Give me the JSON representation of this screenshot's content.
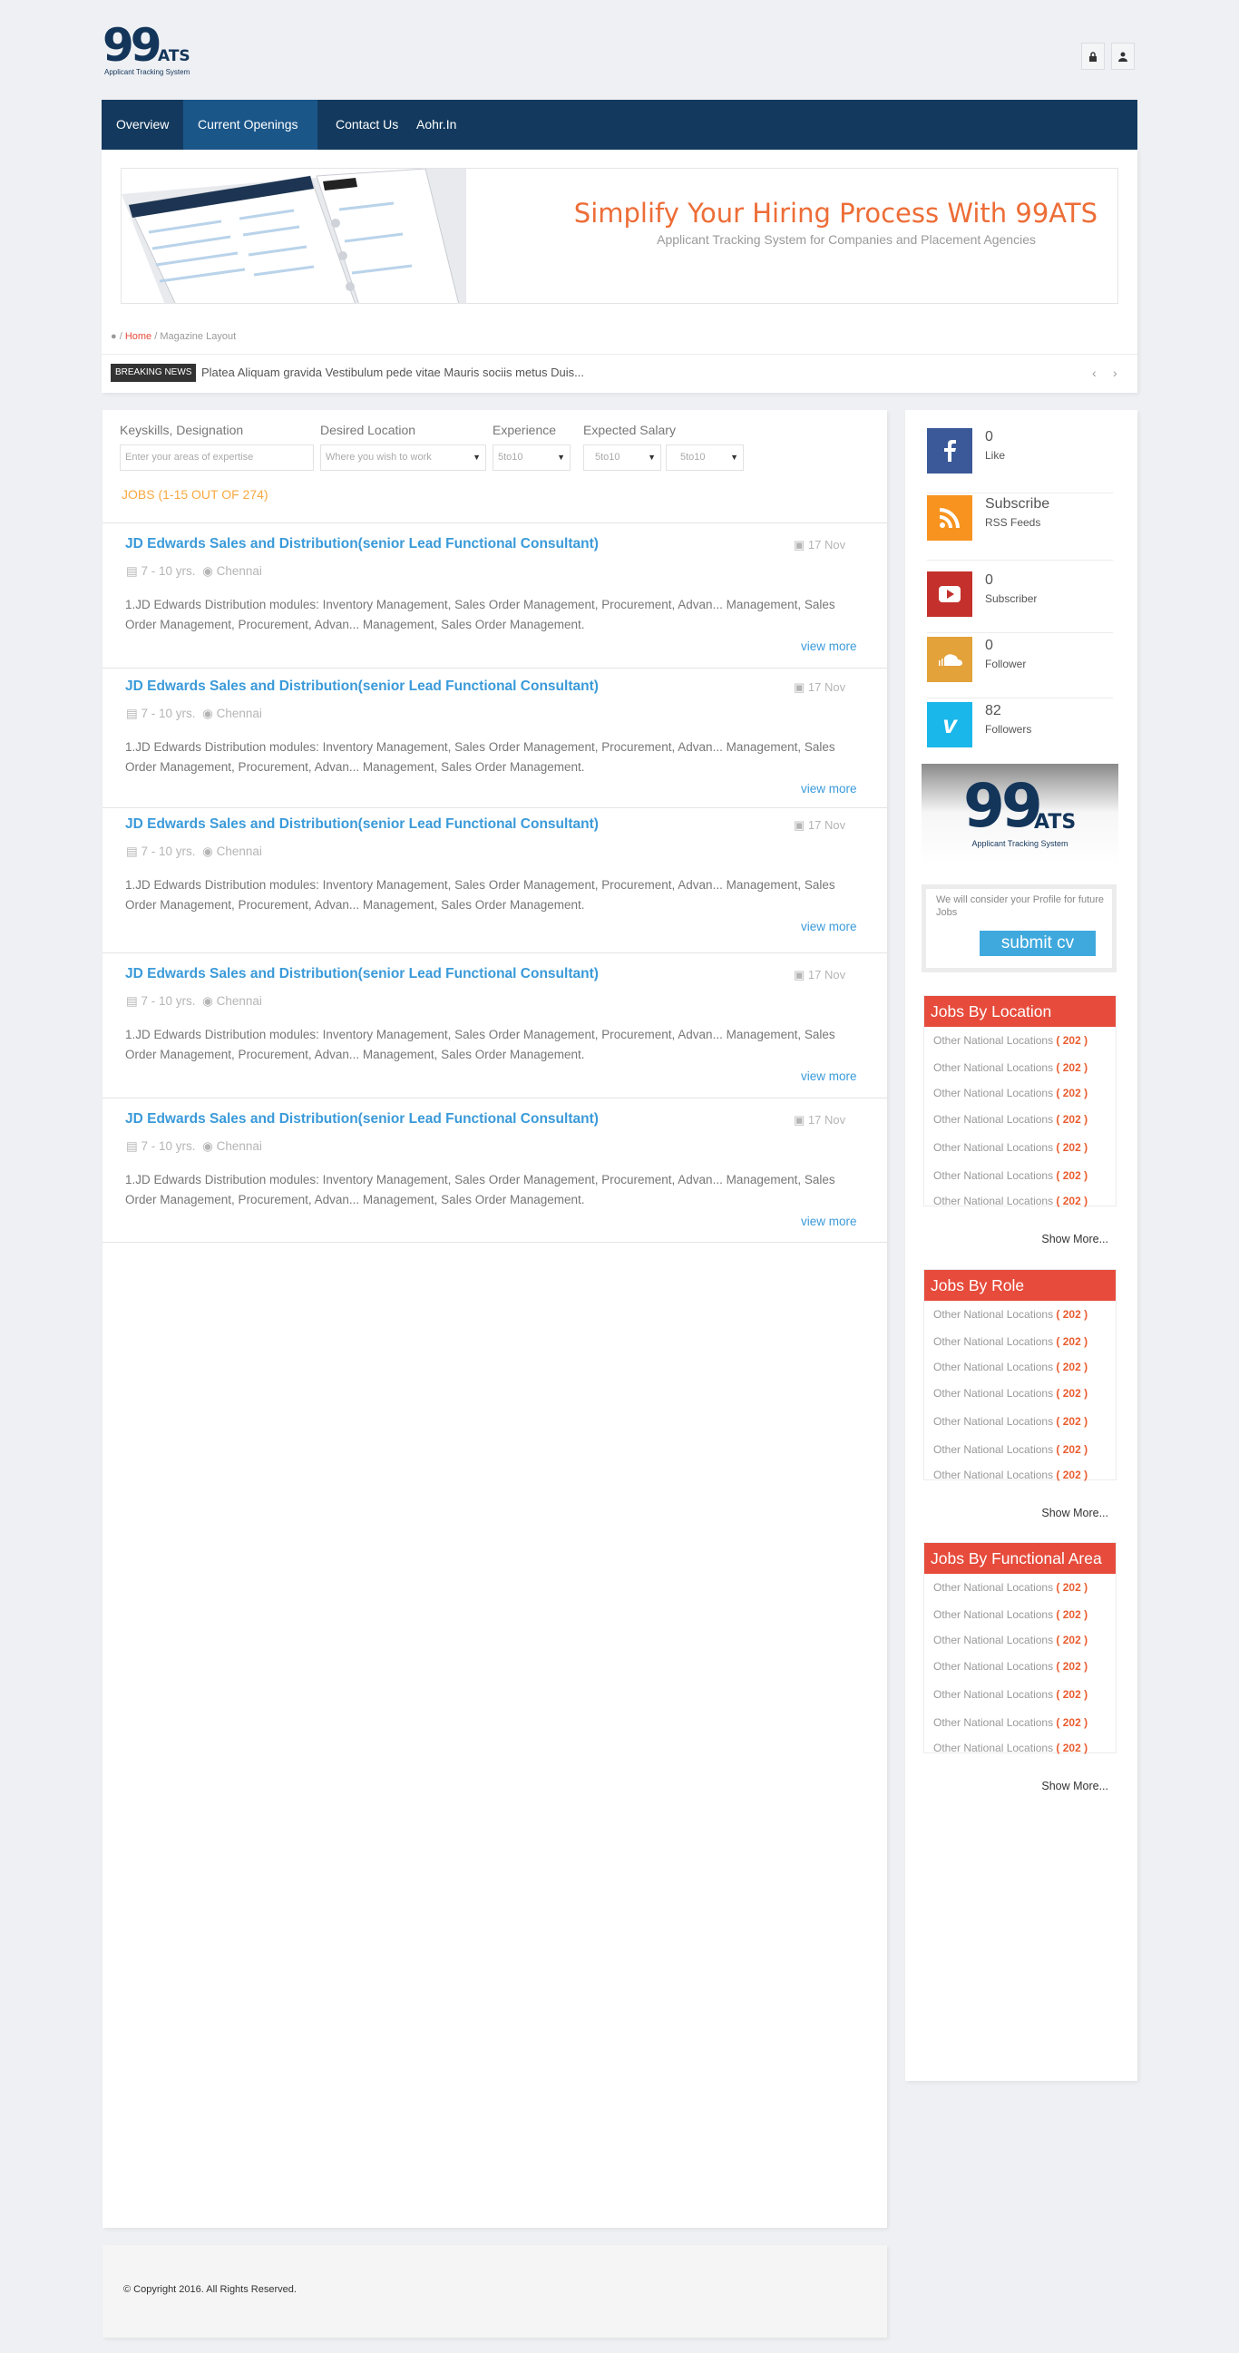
{
  "logo": {
    "number": "99",
    "suffix": "ATS",
    "tagline": "Applicant Tracking System"
  },
  "nav": {
    "items": [
      "Overview",
      "Current Openings",
      "Contact Us",
      "Aohr.In"
    ],
    "active": "Current Openings"
  },
  "banner": {
    "title": "Simplify Your Hiring Process With 99ATS",
    "subtitle": "Applicant Tracking System for Companies and Placement Agencies"
  },
  "breadcrumb": {
    "home": "Home",
    "current": "Magazine Layout"
  },
  "news": {
    "badge": "BREAKING NEWS",
    "text": "Platea Aliquam gravida Vestibulum pede vitae Mauris sociis metus Duis..."
  },
  "search": {
    "keyskills_label": "Keyskills, Designation",
    "keyskills_placeholder": "Enter your areas of expertise",
    "location_label": "Desired Location",
    "location_placeholder": "Where you wish to work",
    "experience_label": "Experience",
    "experience_value": "5to10",
    "salary_label": "Expected Salary",
    "salary_min": "5to10",
    "salary_max": "5to10"
  },
  "jobs_count": "JOBS (1-15 OUT OF 274)",
  "jobs": [
    {
      "title": "JD Edwards Sales and Distribution(senior Lead Functional Consultant)",
      "date": "17 Nov",
      "experience": "7 - 10 yrs.",
      "location": "Chennai",
      "description": "1.JD Edwards Distribution modules: Inventory Management, Sales Order  Management, Procurement, Advan... Management, Sales Order  Management, Procurement, Advan... Management, Sales Order  Management.",
      "link": "view more"
    },
    {
      "title": "JD Edwards Sales and Distribution(senior Lead Functional Consultant)",
      "date": "17 Nov",
      "experience": "7 - 10 yrs.",
      "location": "Chennai",
      "description": "1.JD Edwards Distribution modules: Inventory Management, Sales Order  Management, Procurement, Advan... Management, Sales Order  Management, Procurement, Advan... Management, Sales Order  Management.",
      "link": "view more"
    },
    {
      "title": "JD Edwards Sales and Distribution(senior Lead Functional Consultant)",
      "date": "17 Nov",
      "experience": "7 - 10 yrs.",
      "location": "Chennai",
      "description": "1.JD Edwards Distribution modules: Inventory Management, Sales Order  Management, Procurement, Advan... Management, Sales Order  Management, Procurement, Advan... Management, Sales Order  Management.",
      "link": "view more"
    },
    {
      "title": "JD Edwards Sales and Distribution(senior Lead Functional Consultant)",
      "date": "17 Nov",
      "experience": "7 - 10 yrs.",
      "location": "Chennai",
      "description": "1.JD Edwards Distribution modules: Inventory Management, Sales Order  Management, Procurement, Advan... Management, Sales Order  Management, Procurement, Advan... Management, Sales Order  Management.",
      "link": "view more"
    },
    {
      "title": "JD Edwards Sales and Distribution(senior Lead Functional Consultant)",
      "date": "17 Nov",
      "experience": "7 - 10 yrs.",
      "location": "Chennai",
      "description": "1.JD Edwards Distribution modules: Inventory Management, Sales Order  Management, Procurement, Advan... Management, Sales Order  Management, Procurement, Advan... Management, Sales Order  Management.",
      "link": "view more"
    }
  ],
  "social": [
    {
      "icon": "facebook-icon",
      "value": "0",
      "label": "Like",
      "color": "#3b5998"
    },
    {
      "icon": "rss-icon",
      "value": "Subscribe",
      "label": "RSS Feeds",
      "color": "#f7931e"
    },
    {
      "icon": "youtube-icon",
      "value": "0",
      "label": "Subscriber",
      "color": "#c4302b"
    },
    {
      "icon": "soundcloud-icon",
      "value": "0",
      "label": "Follower",
      "color": "#e3a23a"
    },
    {
      "icon": "vimeo-icon",
      "value": "82",
      "label": "Followers",
      "color": "#1ab7ea"
    }
  ],
  "cv": {
    "text": "We will consider your Profile for future Jobs",
    "button": "submit cv"
  },
  "categories": [
    {
      "title": "Jobs By Location",
      "items": [
        "Other National Locations",
        "Other National Locations",
        "Other National Locations",
        "Other National Locations",
        "Other National Locations",
        "Other National Locations",
        "Other National Locations"
      ],
      "count": "( 202 )",
      "more": "Show More..."
    },
    {
      "title": "Jobs By Role",
      "items": [
        "Other National Locations",
        "Other National Locations",
        "Other National Locations",
        "Other National Locations",
        "Other National Locations",
        "Other National Locations",
        "Other National Locations"
      ],
      "count": "( 202 )",
      "more": "Show More..."
    },
    {
      "title": "Jobs By Functional Area",
      "items": [
        "Other National Locations",
        "Other National Locations",
        "Other National Locations",
        "Other National Locations",
        "Other National Locations",
        "Other National Locations",
        "Other National Locations"
      ],
      "count": "( 202 )",
      "more": "Show More..."
    }
  ],
  "footer": {
    "copyright": "© Copyright 2016. All Rights Reserved."
  },
  "colors": {
    "navbar": "#133a5e",
    "nav_active": "#1b5689",
    "accent_red": "#e64b3b",
    "link_blue": "#3a9ad9",
    "orange": "#ed6d37"
  }
}
